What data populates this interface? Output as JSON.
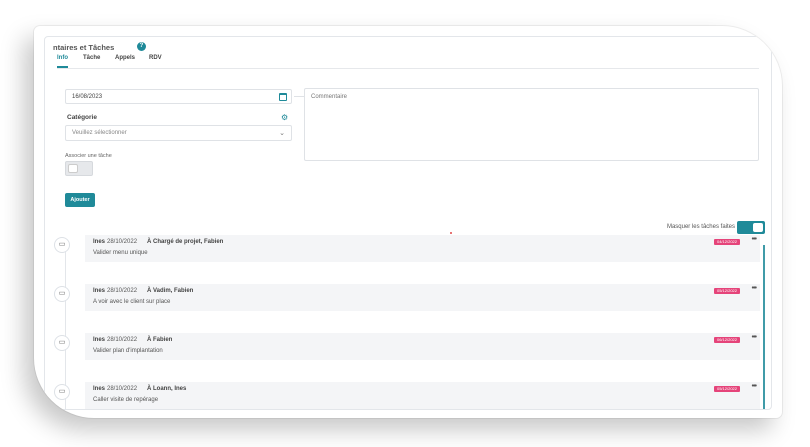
{
  "panel": {
    "title": "ntaires et Tâches",
    "help_icon": "?"
  },
  "tabs": [
    {
      "label": "Info",
      "active": true
    },
    {
      "label": "Tâche",
      "active": false
    },
    {
      "label": "Appels",
      "active": false
    },
    {
      "label": "RDV",
      "active": false
    }
  ],
  "form": {
    "date_value": "16/08/2023",
    "comment_placeholder": "Commentaire",
    "category_label": "Catégorie",
    "category_placeholder": "Veuillez sélectionner",
    "associate_label": "Associer une tâche",
    "associate_on": false,
    "add_button": "Ajouter"
  },
  "filter": {
    "hide_done_label": "Masquer les tâches faites",
    "hide_done_on": true
  },
  "colors": {
    "accent": "#1f8a99",
    "badge": "#e5447a"
  },
  "tasks": [
    {
      "author": "Ines",
      "date": "28/10/2022",
      "assignee": "À Chargé de projet, Fabien",
      "title": "Valider menu unique",
      "due": "04/12/2022"
    },
    {
      "author": "Ines",
      "date": "28/10/2022",
      "assignee": "À Vadim, Fabien",
      "title": "A voir avec le client sur place",
      "due": "05/12/2022"
    },
    {
      "author": "Ines",
      "date": "28/10/2022",
      "assignee": "À Fabien",
      "title": "Valider plan d'implantation",
      "due": "06/12/2022"
    },
    {
      "author": "Ines",
      "date": "28/10/2022",
      "assignee": "À Loann, Ines",
      "title": "Caller visite de repérage",
      "due": "05/12/2022"
    }
  ]
}
